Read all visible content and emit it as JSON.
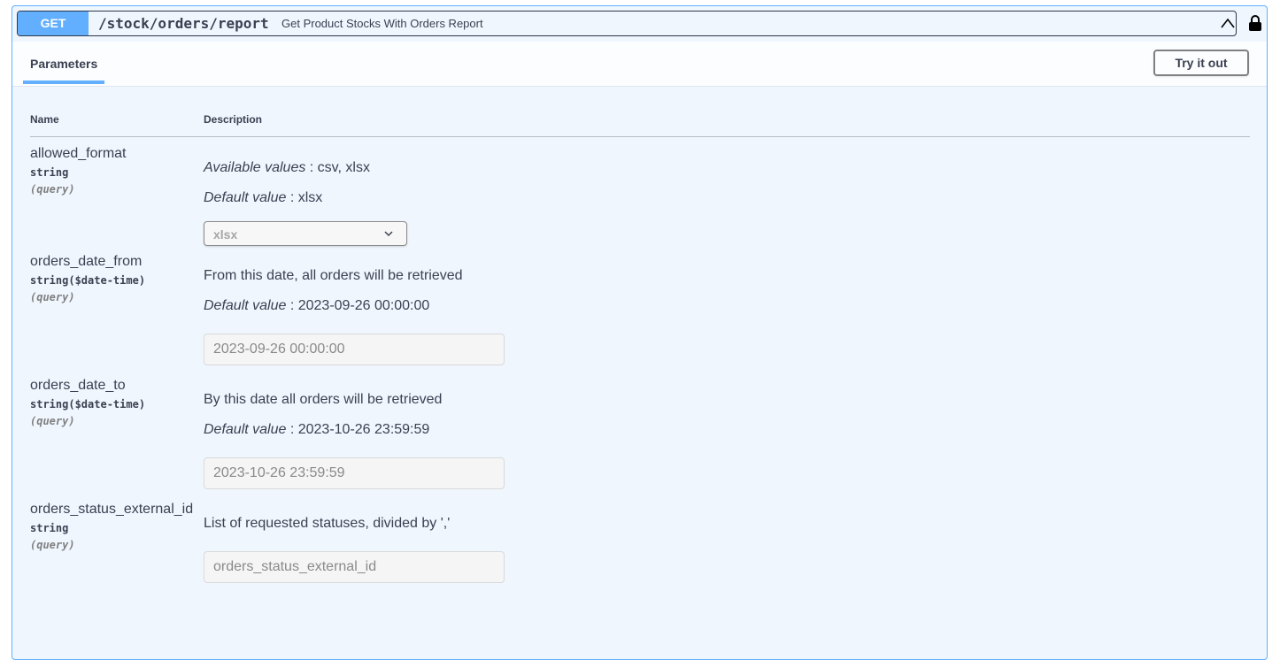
{
  "operation": {
    "method": "GET",
    "path": "/stock/orders/report",
    "summary": "Get Product Stocks With Orders Report"
  },
  "section": {
    "tab_label": "Parameters",
    "try_button": "Try it out"
  },
  "columns": {
    "name": "Name",
    "description": "Description"
  },
  "params": [
    {
      "name": "allowed_format",
      "type": "string",
      "in": "(query)",
      "available_label": "Available values",
      "available_values": " : csv, xlsx",
      "default_label": "Default value",
      "default_value": " : xlsx",
      "select_value": "xlsx"
    },
    {
      "name": "orders_date_from",
      "type": "string($date-time)",
      "in": "(query)",
      "description": "From this date, all orders will be retrieved",
      "default_label": "Default value",
      "default_value": " : 2023-09-26 00:00:00",
      "input_placeholder": "2023-09-26 00:00:00"
    },
    {
      "name": "orders_date_to",
      "type": "string($date-time)",
      "in": "(query)",
      "description": "By this date all orders will be retrieved",
      "default_label": "Default value",
      "default_value": " : 2023-10-26 23:59:59",
      "input_placeholder": "2023-10-26 23:59:59"
    },
    {
      "name": "orders_status_external_id",
      "type": "string",
      "in": "(query)",
      "description": "List of requested statuses, divided by ','",
      "input_placeholder": "orders_status_external_id"
    }
  ],
  "icons": {
    "collapse": "chevron-up-icon",
    "lock": "lock-icon",
    "select_arrow": "chevron-down-icon"
  },
  "colors": {
    "get_method": "#61affe",
    "block_background": "#eff6fe",
    "text": "#3b4151"
  }
}
